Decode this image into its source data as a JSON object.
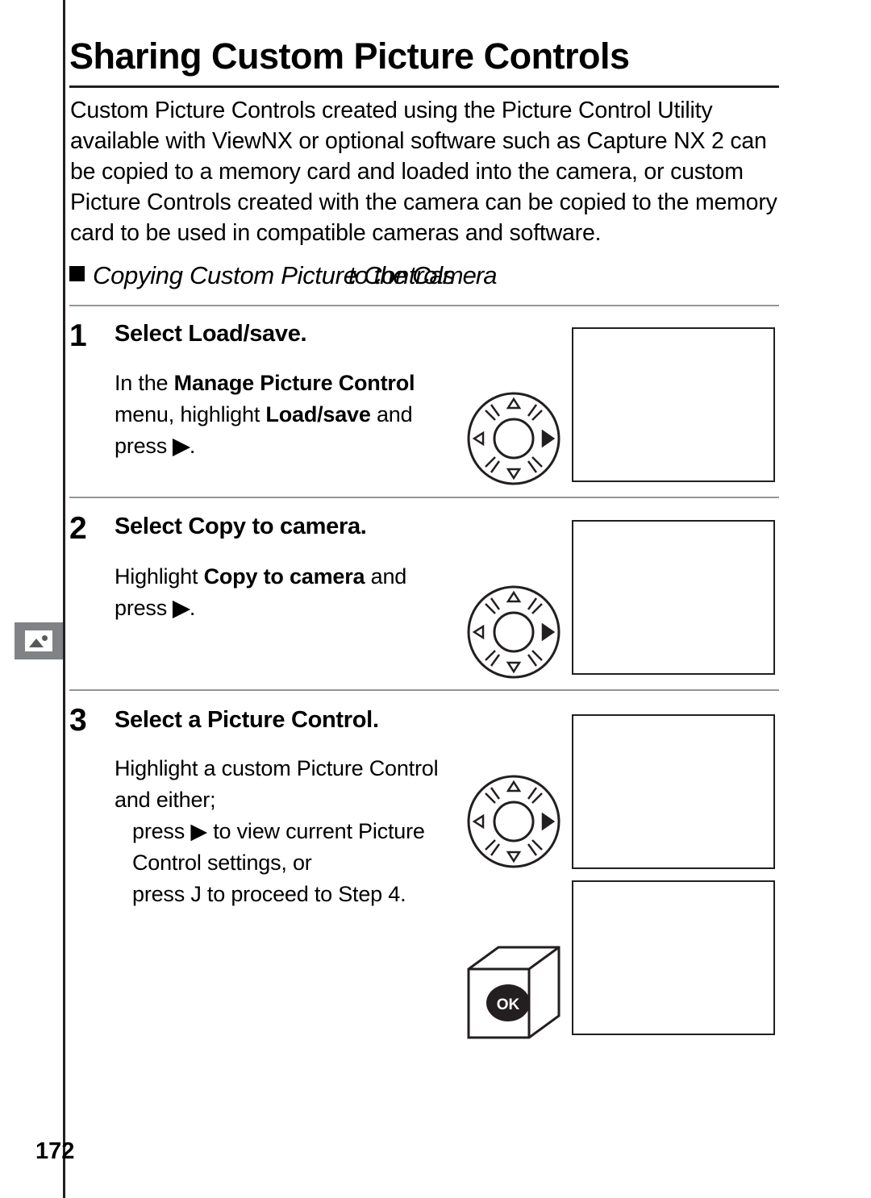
{
  "page": {
    "title": "Sharing Custom Picture Controls",
    "number": "172",
    "side_tab_icon": "picture-control-icon"
  },
  "intro": "Custom Picture Controls created using the Picture Control Utility available with ViewNX or optional software such as Capture NX 2 can be copied to a memory card and loaded into the camera, or custom Picture Controls created with the camera can be copied to the memory card to be used in compatible cameras and software.",
  "section": {
    "heading_a": "Copying Custom Picture Controls",
    "heading_b": "to the Camera",
    "bullet": "square-bullet-icon"
  },
  "steps": [
    {
      "number": "1",
      "title": "Select Load/save.",
      "body_html": "In the <b>Manage Picture Control</b> menu, highlight <b>Load/save</b> and press <b>▶</b>.",
      "control_icon": "multi-selector-right-icon",
      "screen": ""
    },
    {
      "number": "2",
      "title": "Select Copy to camera.",
      "body_html": "Highlight <b>Copy to camera</b> and press <b>▶</b>.",
      "control_icon": "multi-selector-right-icon",
      "screen": ""
    },
    {
      "number": "3",
      "title": "Select a Picture Control.",
      "body_html": "Highlight a custom Picture Control and either;",
      "body_extra_1": "press ▶ to view current Picture Control settings, or",
      "body_extra_2": "press J to proceed to Step 4.",
      "control_icon": "multi-selector-right-icon",
      "control_icon_2": "ok-button-icon",
      "ok_label": "OK",
      "screen": "",
      "screen_2": ""
    }
  ]
}
